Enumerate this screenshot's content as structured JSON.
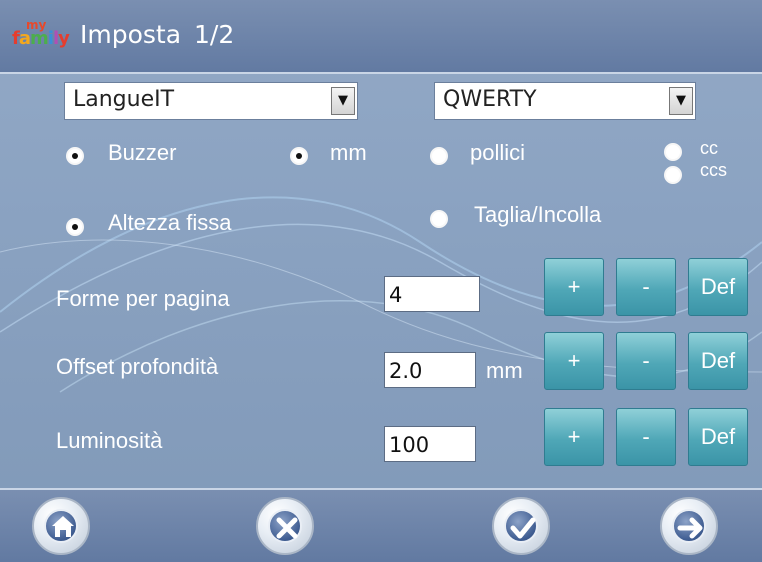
{
  "header": {
    "logo_top": "my",
    "logo_main": "family",
    "title": "Imposta",
    "page": "1/2"
  },
  "dropdowns": {
    "language": {
      "value": "LangueIT"
    },
    "keyboard": {
      "value": "QWERTY"
    }
  },
  "options": {
    "buzzer": {
      "label": "Buzzer",
      "selected": true
    },
    "mm": {
      "label": "mm",
      "selected": true
    },
    "pollici": {
      "label": "pollici",
      "selected": false
    },
    "cc": {
      "label": "cc",
      "selected": false
    },
    "ccs": {
      "label": "ccs",
      "selected": false
    },
    "altezza_fissa": {
      "label": "Altezza fissa",
      "selected": true
    },
    "taglia_incolla": {
      "label": "Taglia/Incolla",
      "selected": false
    }
  },
  "settings": [
    {
      "label": "Forme per pagina",
      "value": "4",
      "unit": ""
    },
    {
      "label": "Offset profondità",
      "value": "2.0",
      "unit": "mm"
    },
    {
      "label": "Luminosità",
      "value": "100",
      "unit": ""
    }
  ],
  "buttons": {
    "plus": "+",
    "minus": "-",
    "default": "Def"
  },
  "footer": {
    "icons": [
      "home-icon",
      "cancel-icon",
      "confirm-icon",
      "next-icon"
    ]
  },
  "colors": {
    "title_bar": "#627aa2",
    "background": "#8aa2c1",
    "button_teal": "#4fa7b7",
    "round_button_blue": "#3e5c91"
  }
}
